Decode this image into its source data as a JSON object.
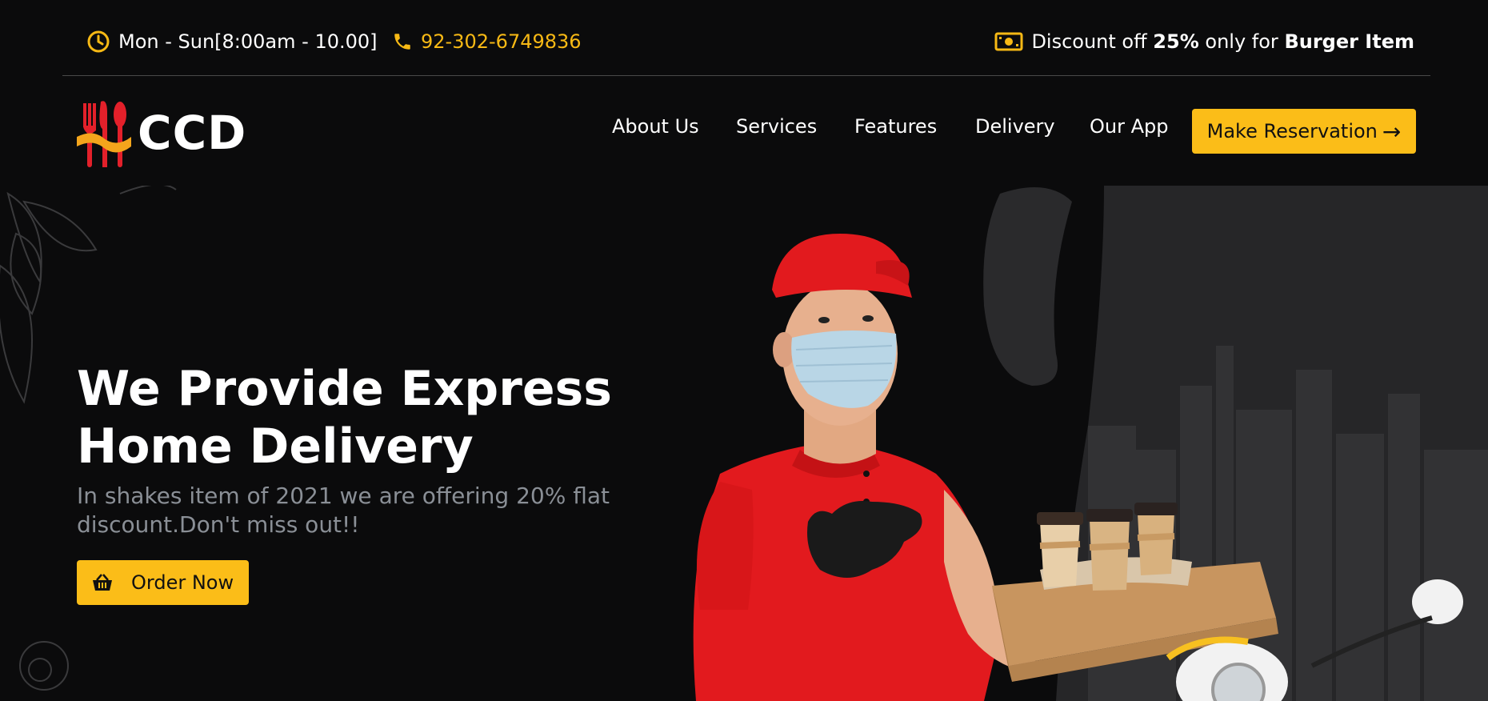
{
  "topbar": {
    "hours_text": "Mon - Sun[8:00am - 10.00]",
    "phone_text": "92-302-6749836",
    "discount_prefix": "Discount off",
    "discount_value": "25%",
    "discount_mid": "only for",
    "discount_item": "Burger Item"
  },
  "brand": {
    "name": "CCD"
  },
  "nav": {
    "items": [
      "About Us",
      "Services",
      "Features",
      "Delivery",
      "Our App"
    ],
    "cta_label": "Make Reservation",
    "cta_arrow": "→"
  },
  "hero": {
    "title_line1": "We Provide Express",
    "title_line2": "Home Delivery",
    "subtitle": "In shakes item of 2021 we are offering 20% flat discount.Don't miss out!!",
    "order_label": "Order Now"
  },
  "colors": {
    "background": "#0b0b0c",
    "accent": "#fbbd18",
    "logo_red": "#e3202a",
    "subtitle_gray": "#8a8f96"
  },
  "icons": {
    "hours": "clock-icon",
    "phone": "phone-icon",
    "discount": "money-icon",
    "order": "basket-icon",
    "logo": "fork-knife-spoon-icon"
  }
}
